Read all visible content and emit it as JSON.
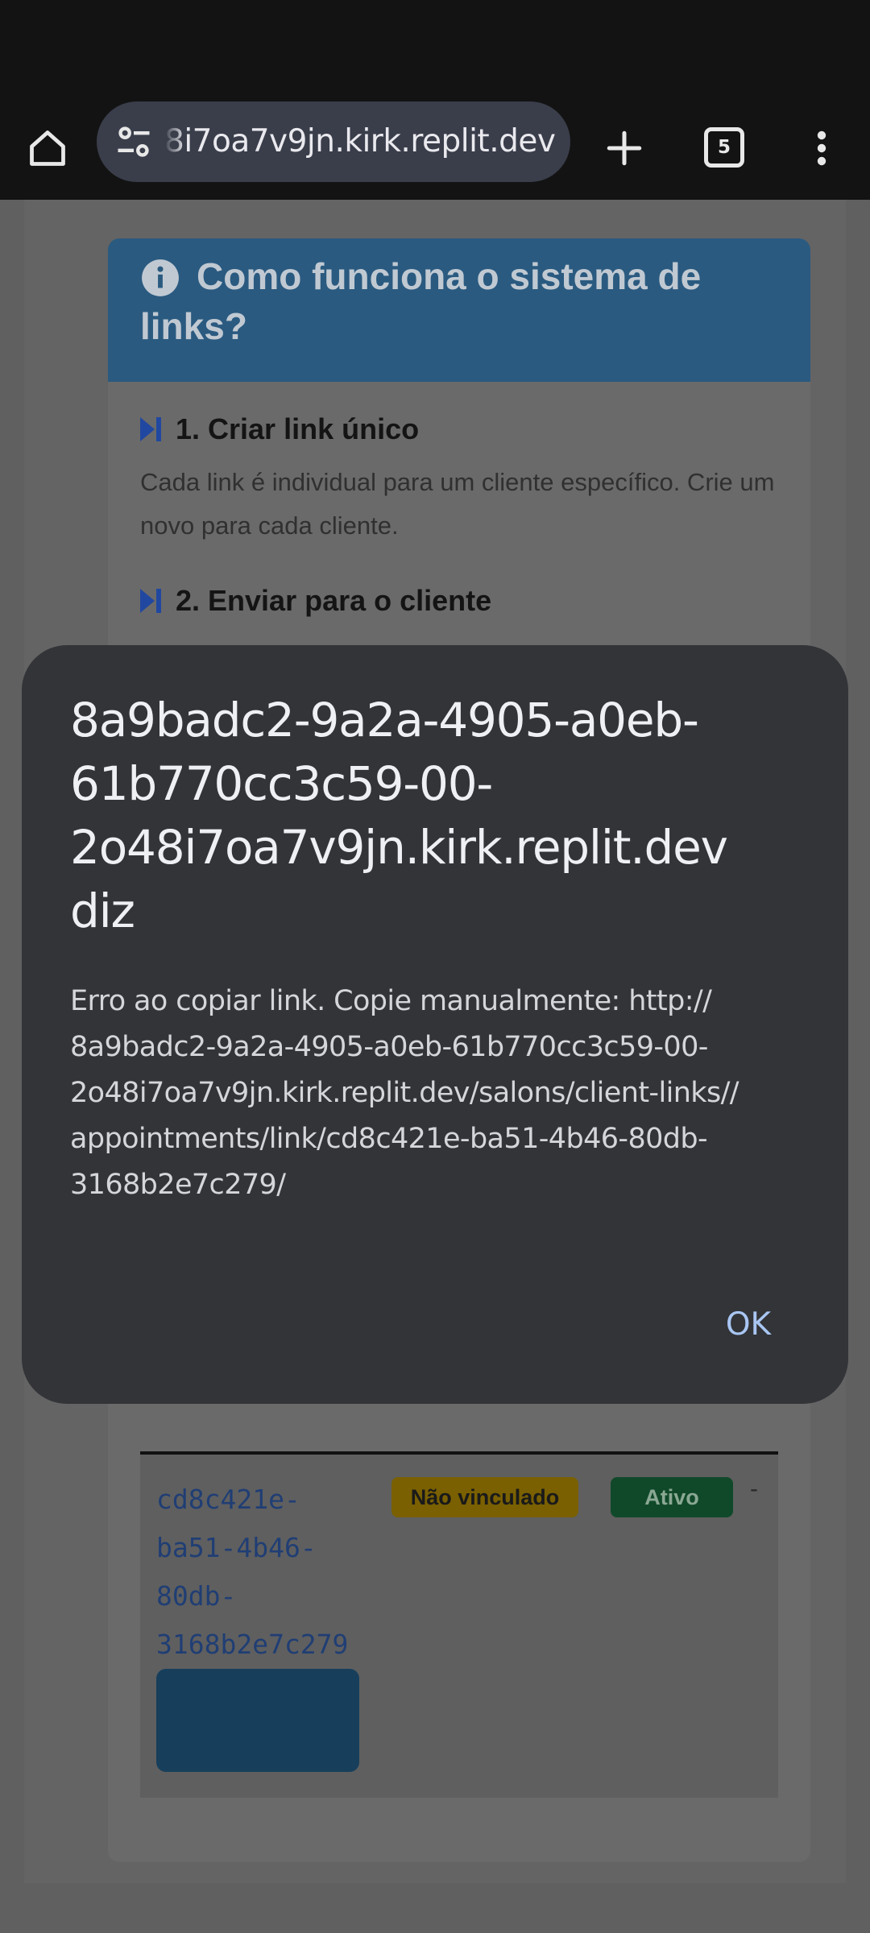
{
  "browser": {
    "url": "8i7oa7v9jn.kirk.replit.dev",
    "tab_count": "5",
    "icons": [
      "home-icon",
      "site-settings-icon",
      "new-tab-icon",
      "tab-switcher-icon",
      "more-menu-icon"
    ]
  },
  "page": {
    "info_title": "Como funciona o sistema de links?",
    "steps": [
      {
        "title": "1. Criar link único",
        "description": "Cada link é individual para um cliente específico. Crie um novo para cada cliente."
      },
      {
        "title": "2. Enviar para o cliente"
      }
    ],
    "table": {
      "link_id": "cd8c421e-ba51-4b46-80db-3168b2e7c279",
      "link_status": "Não vinculado",
      "active_status": "Ativo",
      "empty_cell": "-"
    }
  },
  "dialog": {
    "title": "8a9badc2-9a2a-4905-a0eb-61b770cc3c59-00-2o48i7oa7v9jn.kirk.replit.dev diz",
    "message": "Erro ao copiar link. Copie manualmente: http://8a9badc2-9a2a-4905-a0eb-61b770cc3c59-00-2o48i7oa7v9jn.kirk.replit.dev/salons/client-links//appointments/link/cd8c421e-ba51-4b46-80db-3168b2e7c279/",
    "ok_label": "OK"
  },
  "colors": {
    "dialog_bg": "#323438",
    "accent_button": "#a9c6f3",
    "info_header": "#2a5a80",
    "badge_warning": "#7a6000",
    "badge_success": "#10492a"
  }
}
